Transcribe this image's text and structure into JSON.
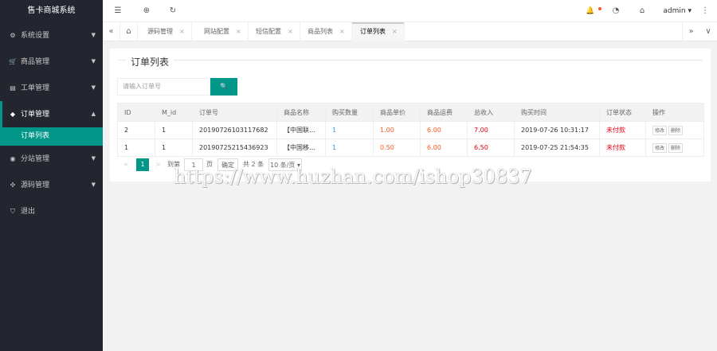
{
  "app": {
    "title": "售卡商城系统"
  },
  "sidebar": {
    "items": [
      {
        "label": "系统设置",
        "icon": "gear-icon",
        "glyph": "⚙",
        "arrow": "▼"
      },
      {
        "label": "商品管理",
        "icon": "cart-icon",
        "glyph": "🛒",
        "arrow": "▼"
      },
      {
        "label": "工单管理",
        "icon": "ticket-icon",
        "glyph": "▤",
        "arrow": "▼"
      },
      {
        "label": "订单管理",
        "icon": "order-icon",
        "glyph": "◆",
        "arrow": "▲"
      },
      {
        "label": "分站管理",
        "icon": "globe-icon",
        "glyph": "◉",
        "arrow": "▼"
      },
      {
        "label": "源码管理",
        "icon": "code-icon",
        "glyph": "✣",
        "arrow": "▼"
      },
      {
        "label": "退出",
        "icon": "shield-icon",
        "glyph": "⛉",
        "arrow": ""
      }
    ],
    "sub_items": [
      {
        "label": "订单列表"
      }
    ]
  },
  "header": {
    "menu_glyph": "☰",
    "globe_glyph": "⊕",
    "refresh_glyph": "↻",
    "bell_glyph": "🔔",
    "theme_glyph": "◔",
    "tag_glyph": "⌂",
    "user": "admin ▾",
    "more_glyph": "⋮"
  },
  "tabs": {
    "prev_glyph": "«",
    "home_glyph": "⌂",
    "next_glyph": "»",
    "down_glyph": "∨",
    "close_glyph": "×",
    "items": [
      {
        "label": "源码管理"
      },
      {
        "label": "网站配置"
      },
      {
        "label": "短信配置"
      },
      {
        "label": "商品列表"
      },
      {
        "label": "订单列表"
      }
    ]
  },
  "page": {
    "title": "订单列表",
    "search_placeholder": "请输入订单号",
    "search_glyph": "🔍"
  },
  "table": {
    "headers": [
      "ID",
      "M_id",
      "订单号",
      "商品名称",
      "购买数量",
      "商品单价",
      "商品运费",
      "总收入",
      "购买时间",
      "订单状态",
      "操作"
    ],
    "rows": [
      {
        "id": "2",
        "mid": "1",
        "order_no": "20190726103117682",
        "name": "【中国联…",
        "qty": "1",
        "price": "1.00",
        "freight": "6.00",
        "total": "7.00",
        "time": "2019-07-26 10:31:17",
        "status": "未付款",
        "op1": "修改",
        "op2": "删除"
      },
      {
        "id": "1",
        "mid": "1",
        "order_no": "20190725215436923",
        "name": "【中国移…",
        "qty": "1",
        "price": "0.50",
        "freight": "6.00",
        "total": "6.50",
        "time": "2019-07-25 21:54:35",
        "status": "未付款",
        "op1": "修改",
        "op2": "删除"
      }
    ]
  },
  "pager": {
    "prev": "<",
    "current": "1",
    "next": ">",
    "goto_label": "到第",
    "page_input": "1",
    "page_unit": "页",
    "confirm": "确定",
    "total": "共 2 条",
    "size": "10 条/页 ▾"
  },
  "watermark": "https://www.huzhan.com/ishop30837"
}
